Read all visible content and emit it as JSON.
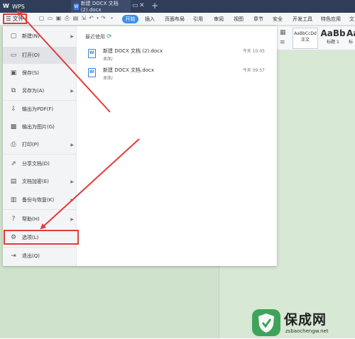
{
  "titlebar": {
    "app_tab": "WPS",
    "doc_tab": "新建 DOCX 文档 (2).docx",
    "doc_badge": "W",
    "new_tab": "+"
  },
  "ribbon": {
    "file_button": "文件",
    "start_tab": "开始",
    "tabs": [
      "插入",
      "页面布局",
      "引用",
      "审阅",
      "视图",
      "章节",
      "安全",
      "开发工具",
      "特色应用",
      "文"
    ]
  },
  "styles": {
    "normal_sample": "AaBbCcDd",
    "normal_label": "正文",
    "heading1_sample": "AaBb",
    "heading1_label": "标题 1",
    "heading2_sample": "AaI",
    "heading2_label": "标"
  },
  "menu": {
    "items": [
      {
        "label": "新建(N)",
        "icon": "new-icon",
        "has_submenu": true
      },
      {
        "label": "打开(O)",
        "icon": "folder-open-icon",
        "has_submenu": false
      },
      {
        "label": "保存(S)",
        "icon": "save-icon",
        "has_submenu": false
      },
      {
        "label": "另存为(A)",
        "icon": "save-as-icon",
        "has_submenu": true
      },
      {
        "label": "输出为PDF(F)",
        "icon": "pdf-icon",
        "has_submenu": false
      },
      {
        "label": "输出为图片(G)",
        "icon": "image-icon",
        "has_submenu": false
      },
      {
        "label": "打印(P)",
        "icon": "print-icon",
        "has_submenu": true
      },
      {
        "label": "分享文档(D)",
        "icon": "share-icon",
        "has_submenu": false
      },
      {
        "label": "文档加密(E)",
        "icon": "encrypt-icon",
        "has_submenu": true
      },
      {
        "label": "备份与恢复(K)",
        "icon": "backup-icon",
        "has_submenu": true
      },
      {
        "label": "帮助(H)",
        "icon": "help-icon",
        "has_submenu": true
      },
      {
        "label": "选项(L)",
        "icon": "gear-icon",
        "has_submenu": false
      },
      {
        "label": "退出(Q)",
        "icon": "exit-icon",
        "has_submenu": false
      }
    ]
  },
  "recent": {
    "title": "最近使用",
    "files": [
      {
        "name": "新建 DOCX 文档 (2).docx",
        "path": "桌面/",
        "time": "今天 10:05"
      },
      {
        "name": "新建 DOCX 文档.docx",
        "path": "桌面/",
        "time": "今天 09:57"
      }
    ]
  },
  "watermark": {
    "title": "保成网",
    "url": "zsbaochengw.net"
  },
  "colors": {
    "titlebar": "#2f3d58",
    "accent": "#3a8ee6",
    "highlight": "#e23b3b",
    "document_bg": "#cfe2cc"
  }
}
